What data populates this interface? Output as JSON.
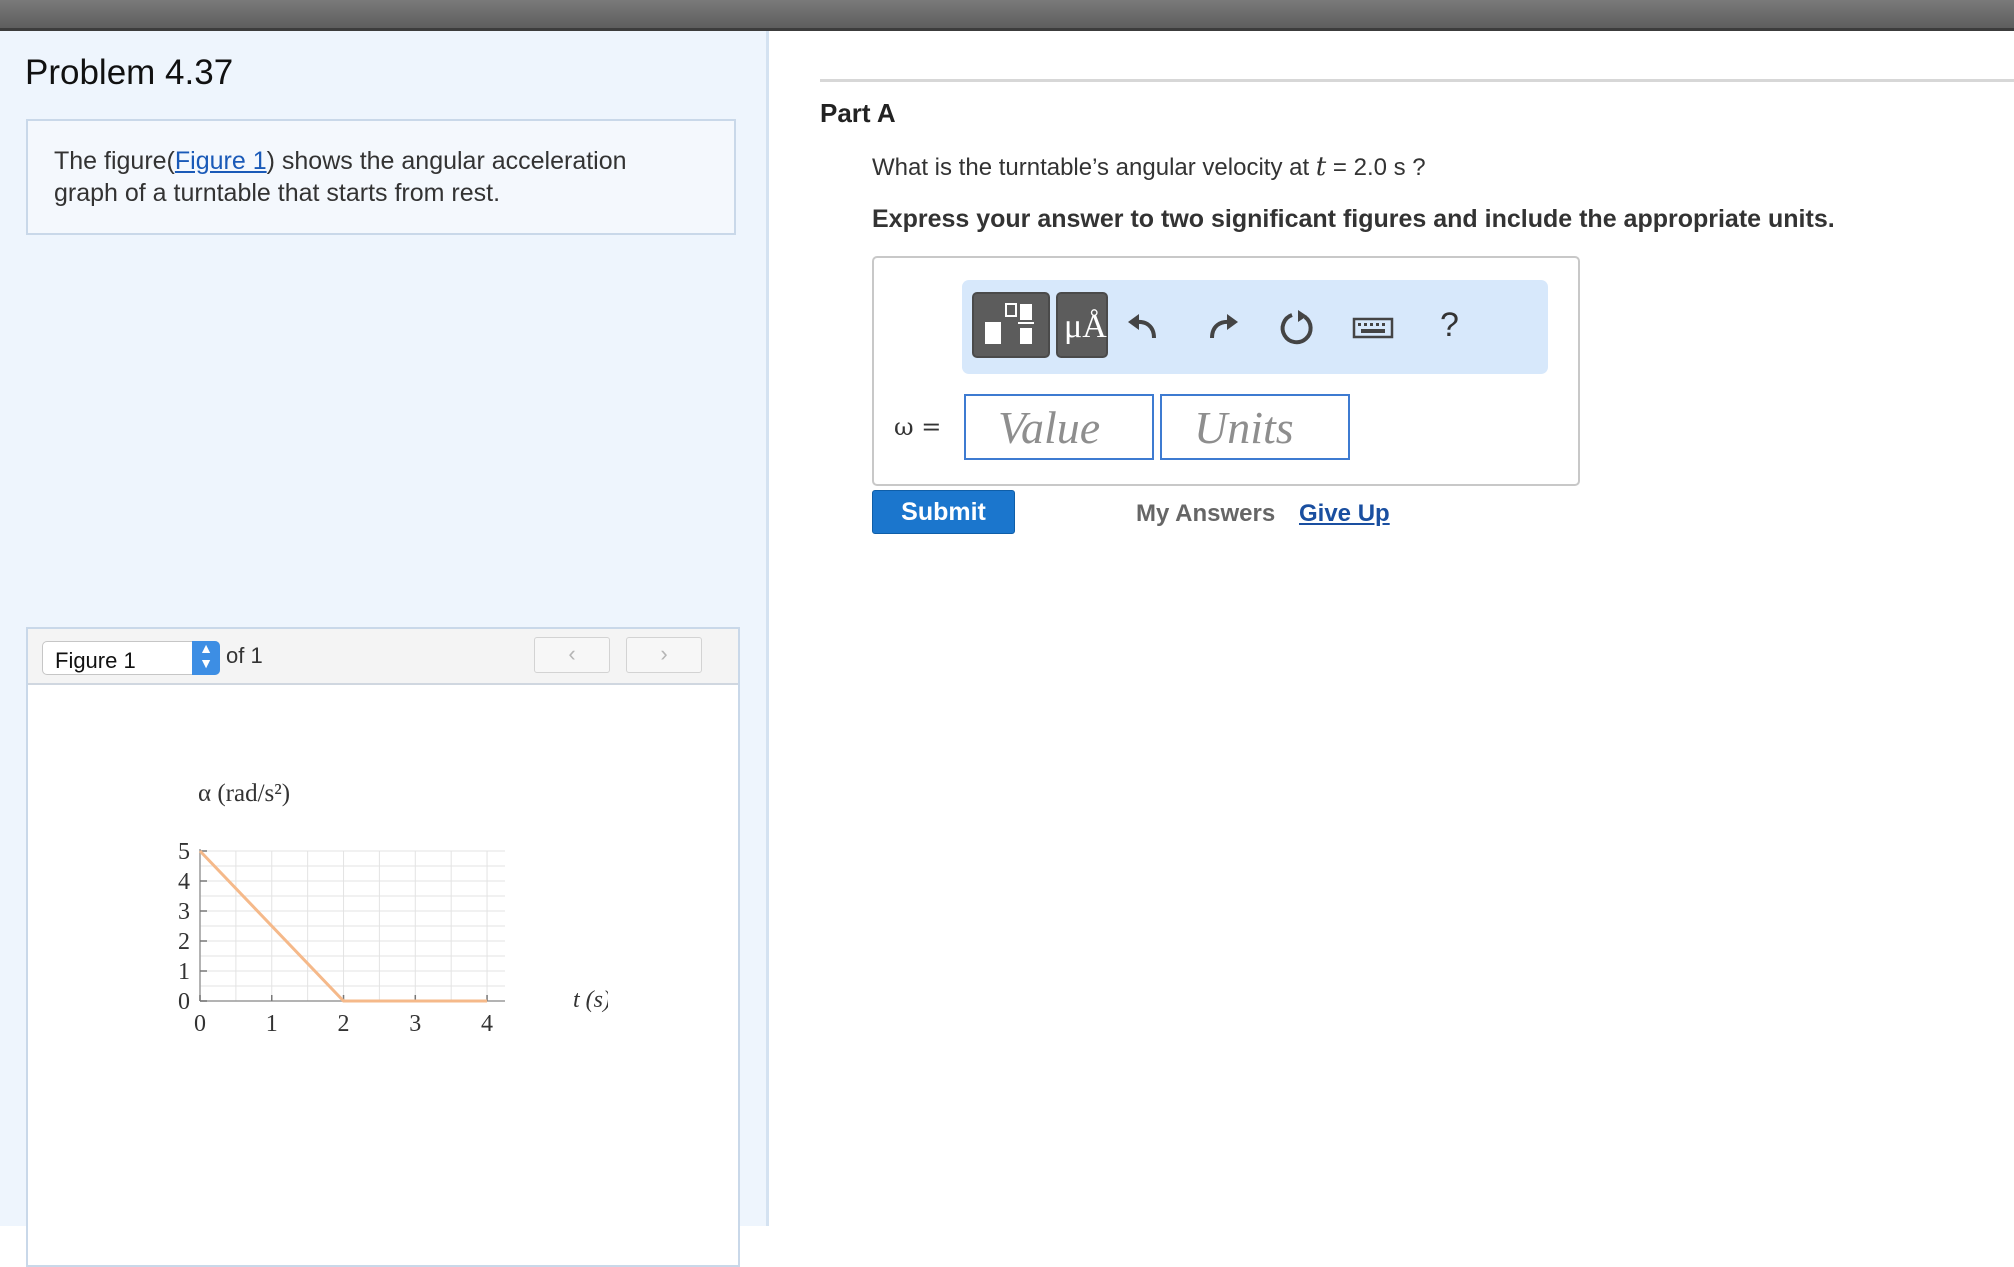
{
  "left_panel": {
    "problem_title": "Problem 4.37",
    "intro_prefix": "The figure(",
    "intro_link": "Figure 1",
    "intro_suffix": ") shows the angular acceleration graph of a turntable that starts from rest."
  },
  "figure_viewer": {
    "selected": "Figure 1",
    "of_text": "of 1",
    "prev_icon": "chevron-left-icon",
    "next_icon": "chevron-right-icon"
  },
  "part": {
    "title": "Part A",
    "question_prefix": "What is the turntable’s angular velocity at",
    "question_var": "t",
    "question_suffix": "= 2.0 s ?",
    "instructions": "Express your answer to two significant figures and include the appropriate units."
  },
  "answer": {
    "toolbar_icons": [
      "templates-icon",
      "symbols-icon",
      "undo-icon",
      "redo-icon",
      "reset-icon",
      "keyboard-icon",
      "help-icon"
    ],
    "symbols_label": "μÅ",
    "help_label": "?",
    "omega_label": "ω =",
    "value_placeholder": "Value",
    "units_placeholder": "Units"
  },
  "actions": {
    "submit": "Submit",
    "my_answers": "My Answers",
    "give_up": "Give Up"
  },
  "colors": {
    "accent": "#1b76cd",
    "line": "#f5b98a",
    "panel_bg": "#eef5fd"
  },
  "chart_data": {
    "type": "line",
    "ylabel": "α (rad/s²)",
    "xlabel": "t (s)",
    "x_ticks": [
      "0",
      "1",
      "2",
      "3",
      "4"
    ],
    "y_ticks": [
      "0",
      "1",
      "2",
      "3",
      "4",
      "5"
    ],
    "xlim": [
      0,
      4.25
    ],
    "ylim": [
      0,
      5
    ],
    "grid": true,
    "series": [
      {
        "x": [
          0,
          2,
          4
        ],
        "y": [
          5,
          0,
          0
        ]
      }
    ]
  }
}
